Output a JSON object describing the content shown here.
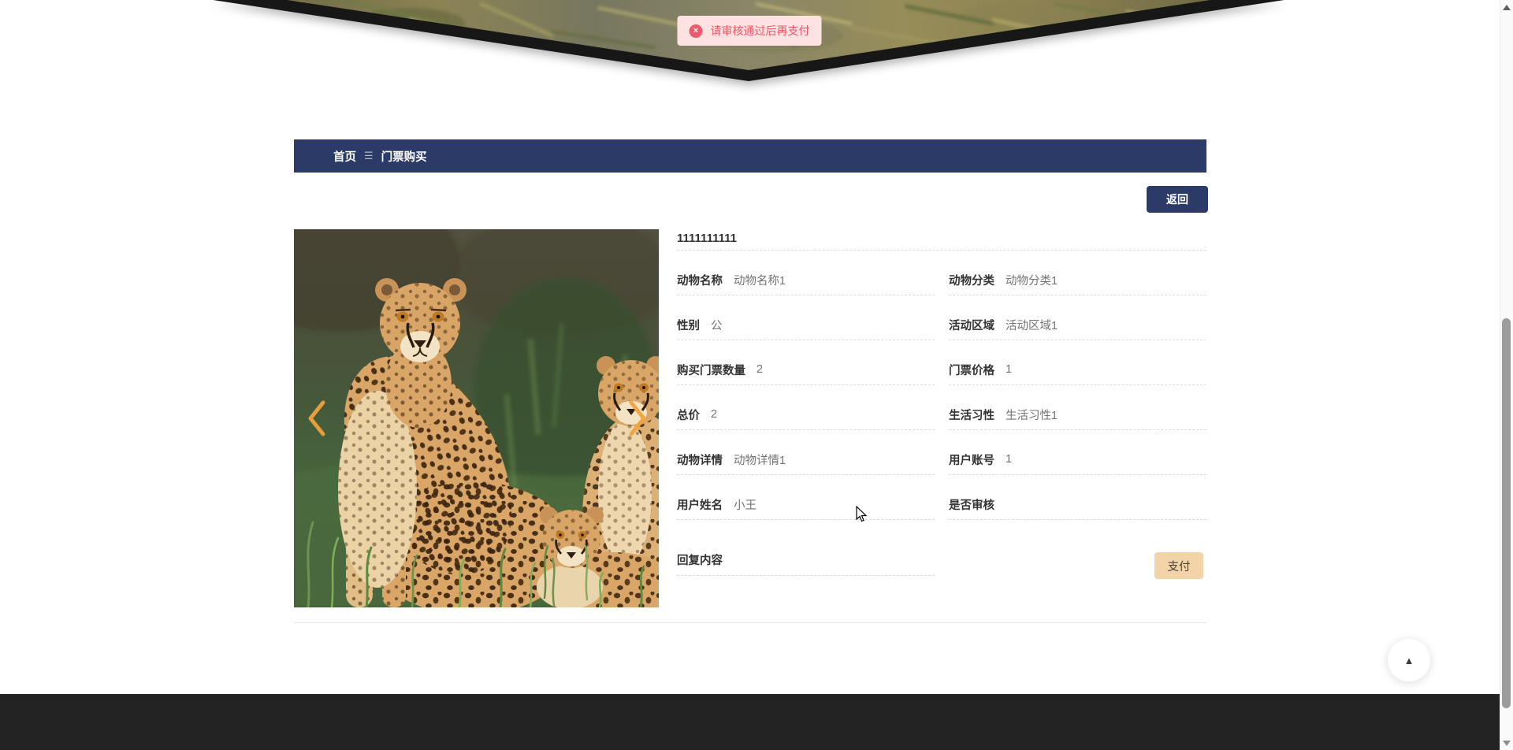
{
  "toast": {
    "message": "请审核通过后再支付",
    "icon_glyph": "×"
  },
  "breadcrumb": {
    "home": "首页",
    "separator_glyph": "☰",
    "current": "门票购买"
  },
  "toolbar": {
    "back_label": "返回"
  },
  "detail": {
    "title": "1111111111",
    "fields": [
      {
        "label": "动物名称",
        "value": "动物名称1"
      },
      {
        "label": "动物分类",
        "value": "动物分类1"
      },
      {
        "label": "性别",
        "value": "公"
      },
      {
        "label": "活动区域",
        "value": "活动区域1"
      },
      {
        "label": "购买门票数量",
        "value": "2"
      },
      {
        "label": "门票价格",
        "value": "1"
      },
      {
        "label": "总价",
        "value": "2"
      },
      {
        "label": "生活习性",
        "value": "生活习性1"
      },
      {
        "label": "动物详情",
        "value": "动物详情1"
      },
      {
        "label": "用户账号",
        "value": "1"
      },
      {
        "label": "用户姓名",
        "value": "小王"
      },
      {
        "label": "是否审核",
        "value": ""
      },
      {
        "label": "回复内容",
        "value": ""
      }
    ],
    "pay_label": "支付"
  },
  "carousel": {
    "prev_icon": "chevron-left-icon",
    "next_icon": "chevron-right-icon",
    "photo_subject": "cheetah family in grass"
  },
  "scroll_top": {
    "icon_glyph": "▲"
  },
  "colors": {
    "accent_navy": "#2b3a67",
    "toast_bg": "#fde2e2",
    "toast_text": "#ef5666",
    "pay_button_bg": "#f3d3a8",
    "footer_bg": "#232323",
    "label_text": "#333333",
    "value_text": "#737373",
    "carousel_arrow": "#f2a33c"
  }
}
